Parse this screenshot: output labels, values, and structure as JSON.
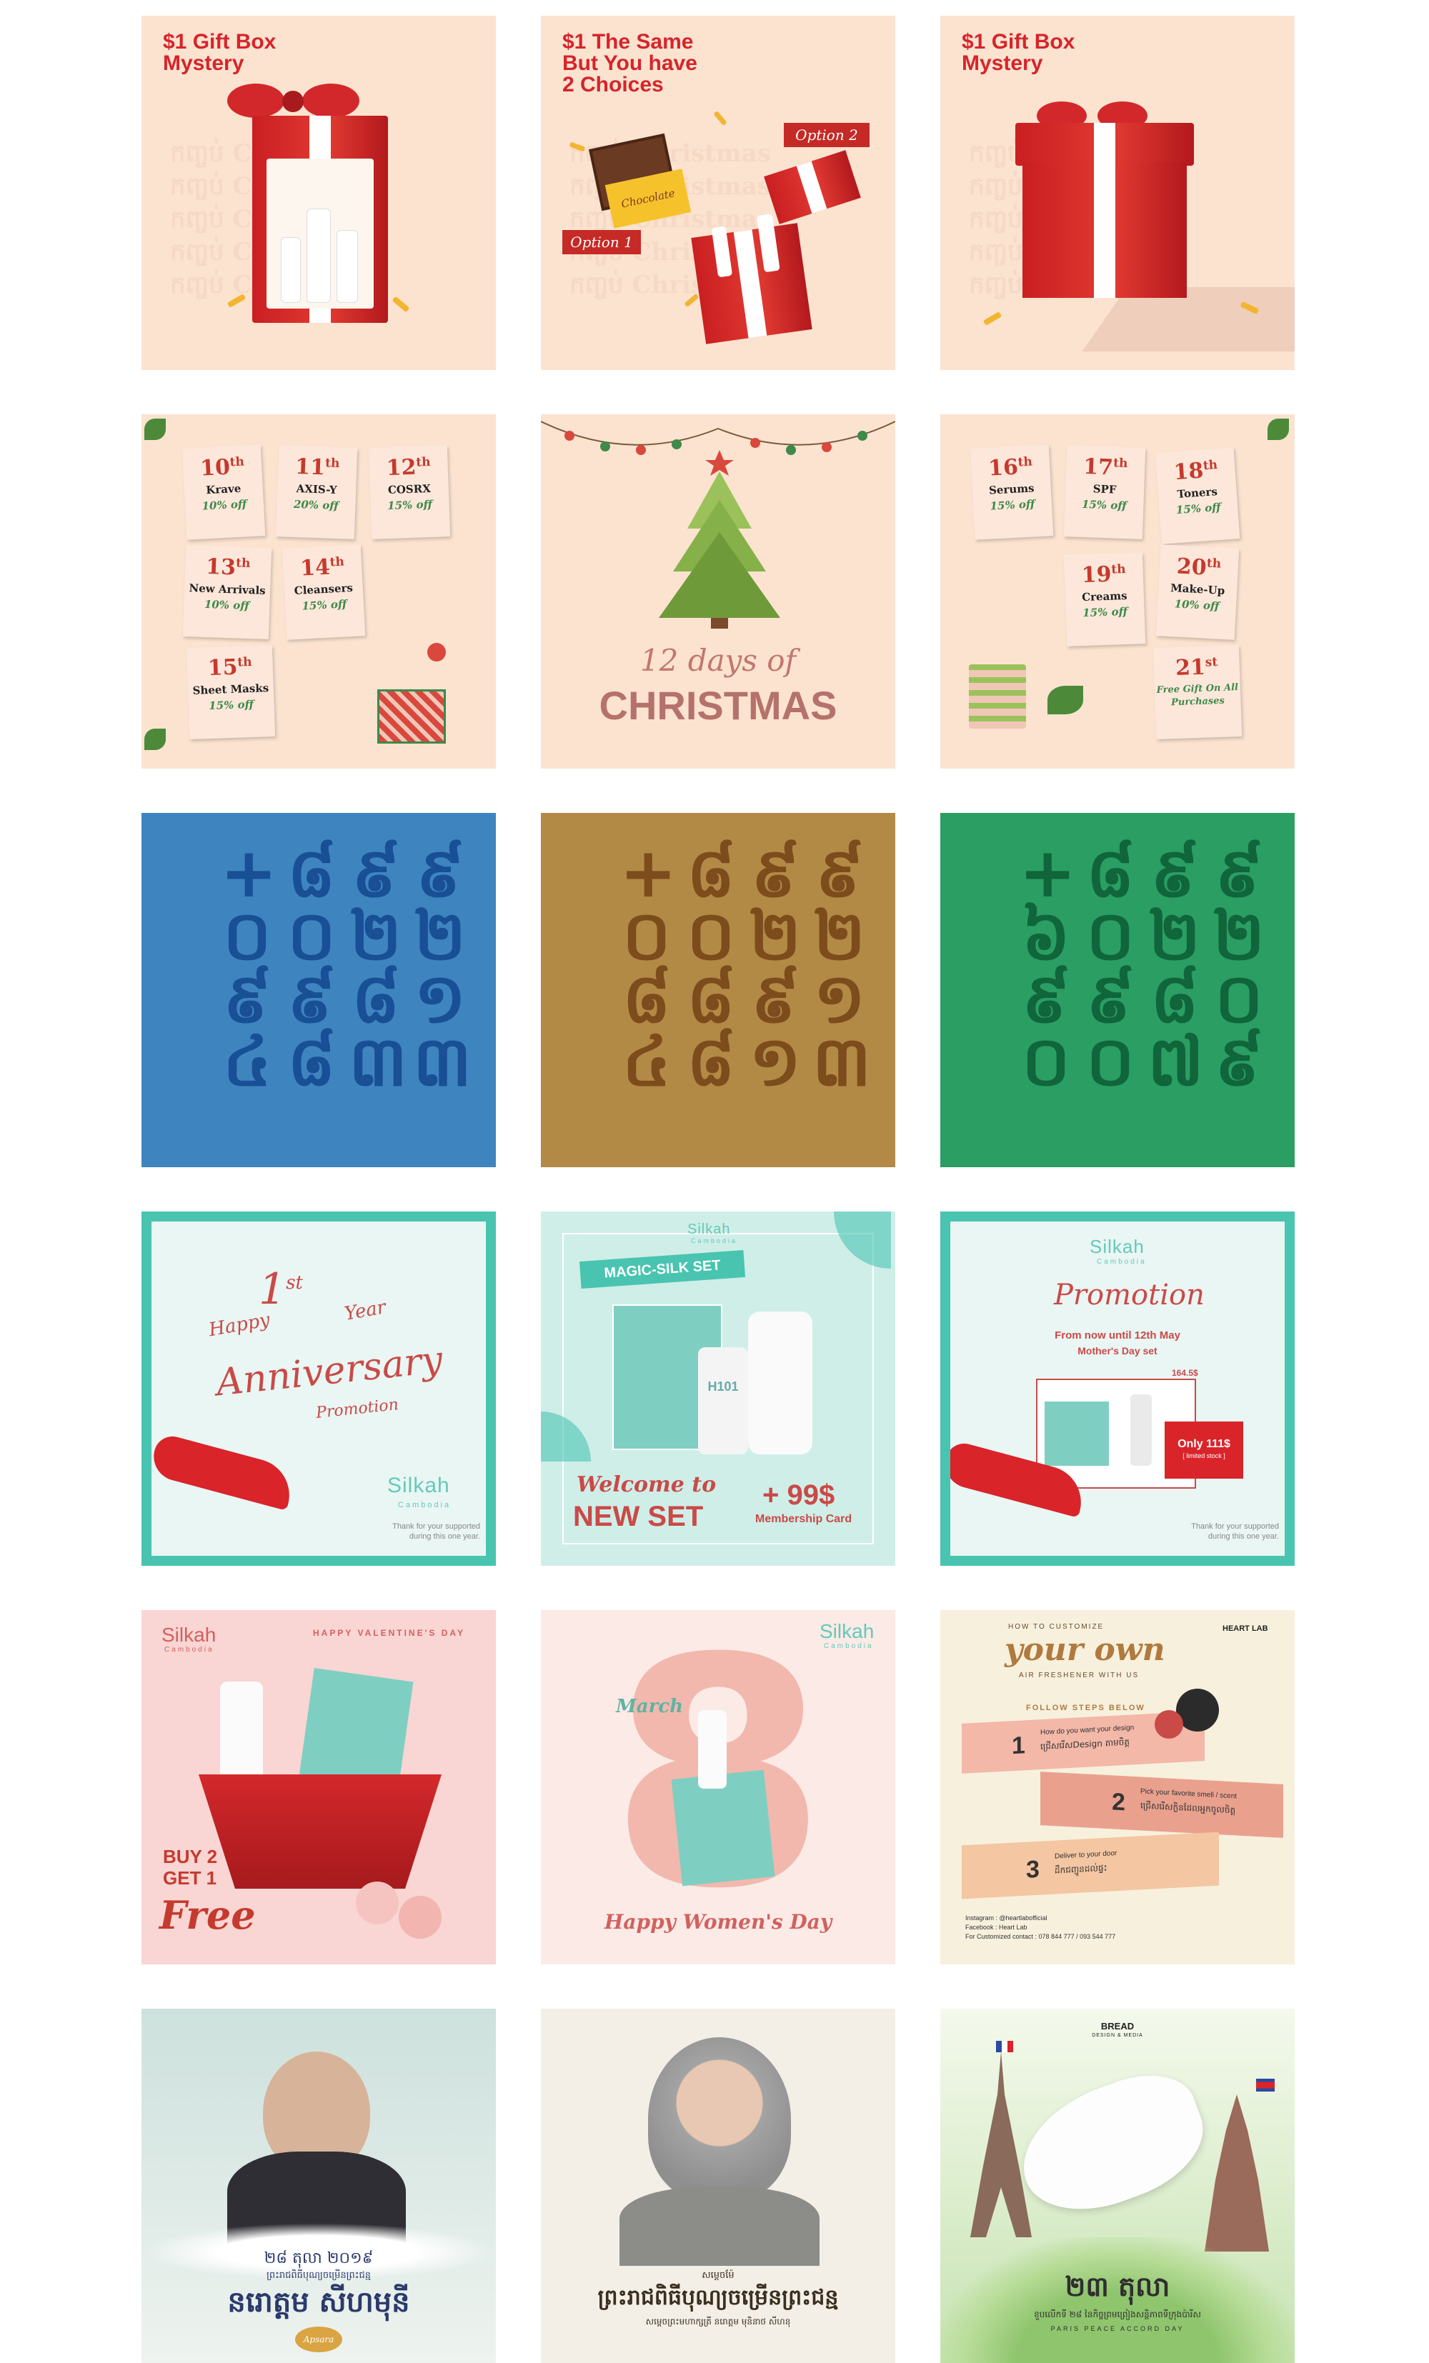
{
  "row1": {
    "tile1": {
      "title_line1": "$1 Gift Box",
      "title_line2": "Mystery",
      "ghost": "កញ្ចប់ Christmas"
    },
    "tile2": {
      "title_line1": "$1 The Same",
      "title_line2": "But You have",
      "title_line3": "2 Choices",
      "option1": "Option 1",
      "option2": "Option 2",
      "chocolate": "Chocolate",
      "ghost": "កញ្ចប់ Christmas"
    },
    "tile3": {
      "title_line1": "$1 Gift Box",
      "title_line2": "Mystery",
      "ghost": "កញ្ចប់ Christmas"
    }
  },
  "row2": {
    "left_notes": [
      {
        "day": "10",
        "suffix": "th",
        "brand": "Krave",
        "off": "10% off"
      },
      {
        "day": "11",
        "suffix": "th",
        "brand": "AXIS-Y",
        "off": "20% off"
      },
      {
        "day": "12",
        "suffix": "th",
        "brand": "COSRX",
        "off": "15% off"
      },
      {
        "day": "13",
        "suffix": "th",
        "brand": "New Arrivals",
        "off": "10% off"
      },
      {
        "day": "14",
        "suffix": "th",
        "brand": "Cleansers",
        "off": "15% off"
      },
      {
        "day": "15",
        "suffix": "th",
        "brand": "Sheet Masks",
        "off": "15% off"
      }
    ],
    "center": {
      "script": "12 days of",
      "headline": "CHRISTMAS"
    },
    "right_notes": [
      {
        "day": "16",
        "suffix": "th",
        "brand": "Serums",
        "off": "15% off"
      },
      {
        "day": "17",
        "suffix": "th",
        "brand": "SPF",
        "off": "15% off"
      },
      {
        "day": "18",
        "suffix": "th",
        "brand": "Toners",
        "off": "15% off"
      },
      {
        "day": "19",
        "suffix": "th",
        "brand": "Creams",
        "off": "15% off"
      },
      {
        "day": "20",
        "suffix": "th",
        "brand": "Make-Up",
        "off": "10% off"
      },
      {
        "day": "21",
        "suffix": "st",
        "brand": "Free Gift On All Purchases",
        "off": ""
      }
    ]
  },
  "row3": {
    "tile1": {
      "color": "#3e85c0",
      "ink": "#184f95",
      "cols": [
        "+០៩៤",
        "៨០៩៨",
        "៩២៨៣",
        "៩២១៣"
      ]
    },
    "tile2": {
      "color": "#b28a45",
      "ink": "#7d4c1c",
      "cols": [
        "+០៨៤",
        "៨០៨៨",
        "៩២៩១",
        "៩២១៣"
      ]
    },
    "tile3": {
      "color": "#2a9e63",
      "ink": "#10653b",
      "cols": [
        "+៦៩០",
        "៨០៩០",
        "៩២៨៧",
        "៩២០៩"
      ]
    }
  },
  "row4": {
    "tile1": {
      "happy": "Happy",
      "year_num": "1",
      "year_sup": "st",
      "year": "Year",
      "anniversary": "Anniversary",
      "promotion": "Promotion",
      "logo": "Silkah",
      "logo_sub": "Cambodia",
      "thanks_line1": "Thank for your supported",
      "thanks_line2": "during this one year."
    },
    "tile2": {
      "logo": "Silkah",
      "logo_sub": "Cambodia",
      "banner": "MAGIC-SILK SET",
      "welcome": "Welcome to",
      "newset": "NEW SET",
      "price": "+ 99$",
      "card": "Membership Card",
      "product": "H101"
    },
    "tile3": {
      "logo": "Silkah",
      "logo_sub": "Cambodia",
      "promotion": "Promotion",
      "from_line": "From now until 12th May",
      "mothers": "Mother's Day set",
      "old_price": "164.5$",
      "only": "Only 111$",
      "limited": "[ limited stock ]",
      "thanks_line1": "Thank for your supported",
      "thanks_line2": "during this one year."
    }
  },
  "row5": {
    "tile1": {
      "logo": "Silkah",
      "logo_sub": "Cambodia",
      "valentine": "HAPPY VALENTINE'S DAY",
      "buy": "BUY 2",
      "get": "GET 1",
      "free": "Free"
    },
    "tile2": {
      "logo": "Silkah",
      "logo_sub": "Cambodia",
      "march": "March",
      "eight": "8",
      "womens": "Happy Women's Day"
    },
    "tile3": {
      "how": "HOW TO CUSTOMIZE",
      "your_own": "your own",
      "air": "AIR FRESHENER WITH US",
      "brand": "HEART LAB",
      "follow": "FOLLOW STEPS BELOW",
      "step1": "How do you want your design",
      "step1_kh": "ជ្រើសរើសDesign តាមចិត្ត",
      "step2": "Pick your favorite smell / scent",
      "step2_kh": "ជ្រើសរើសក្លិនដែលអ្នកចូលចិត្ត",
      "step3": "Deliver to your door",
      "step3_kh": "ដឹកជញ្ជូនដល់ផ្ទះ",
      "n1": "1",
      "n2": "2",
      "n3": "3",
      "insta": "Instagram : @heartlabofficial",
      "facebook": "Facebook : Heart Lab",
      "contact": "For Customized contact : 078 844 777 / 093 544 777"
    }
  },
  "row6": {
    "tile1": {
      "date": "២៨ តុលា ២០១៩",
      "line": "ព្រះរាជពិធីបុណ្យចម្រើនព្រះជន្ម",
      "name": "នរោត្តម សីហមុនី",
      "logo": "Apsara"
    },
    "tile2": {
      "small": "សម្ដេចម៉ែ",
      "line": "ព្រះរាជពិធីបុណ្យចម្រើនព្រះជន្ម",
      "sub": "សម្ដេចព្រះមហាក្សត្រី នរោត្តម មុនិនាថ សីហនុ"
    },
    "tile3": {
      "brand": "BREAD",
      "brand_sub": "DESIGN & MEDIA",
      "date": "២៣ តុលា",
      "line": "ខួបលើកទី ២៨ នៃកិច្ចព្រមព្រៀងសន្តិភាពទីក្រុងប៉ារីស",
      "caption": "PARIS PEACE ACCORD DAY"
    }
  }
}
